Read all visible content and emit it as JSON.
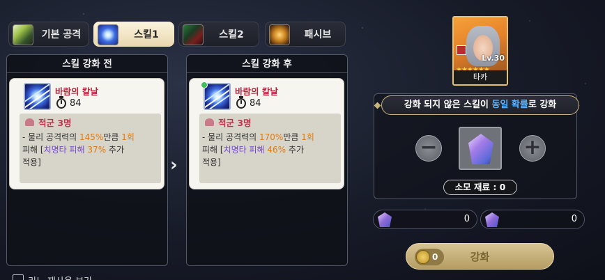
{
  "tabs": [
    {
      "label": "기본 공격",
      "icon": "basic-attack-icon"
    },
    {
      "label": "스킬1",
      "icon": "wind-blade-icon",
      "active": true
    },
    {
      "label": "스킬2",
      "icon": "crossed-swords-icon"
    },
    {
      "label": "패시브",
      "icon": "passive-flame-icon"
    }
  ],
  "before": {
    "header": "스킬 강화 전",
    "skill_name": "바람의 칼날",
    "cooldown": "84",
    "target": "적군 3명",
    "desc": [
      "- 물리 공격력의 ",
      "145%",
      "만큼 ",
      "1회",
      "피해 [",
      "치명타 피해 ",
      "37%",
      " 추가",
      "적용]"
    ]
  },
  "after": {
    "header": "스킬 강화 후",
    "skill_name": "바람의 칼날",
    "cooldown": "84",
    "target": "적군 3명",
    "desc": [
      "- 물리 공격력의 ",
      "170%",
      "만큼 ",
      "1회",
      "피해 [",
      "치명타 피해 ",
      "46%",
      " 추가",
      "적용]"
    ]
  },
  "character": {
    "name": "타카",
    "level": "Lv.30",
    "stars": "★★★★★★"
  },
  "enhance": {
    "banner_pre": "강화 되지 않은 스킬이 ",
    "banner_highlight": "동일 확률",
    "banner_post": "로 강화",
    "consume": "소모 재료 : 0",
    "materials": [
      "0",
      "0"
    ],
    "cost": "0",
    "button_label": "강화"
  },
  "footer": {
    "checkbox_label": "리노 재사용 보기"
  },
  "colors": {
    "active_tab": "#f6edd2",
    "skill_name": "#b7263e",
    "highlight_orange": "#e07a10",
    "highlight_purple": "#7548d6",
    "banner_highlight": "#5ab0ff",
    "enhance_button": "#c8b27a"
  }
}
